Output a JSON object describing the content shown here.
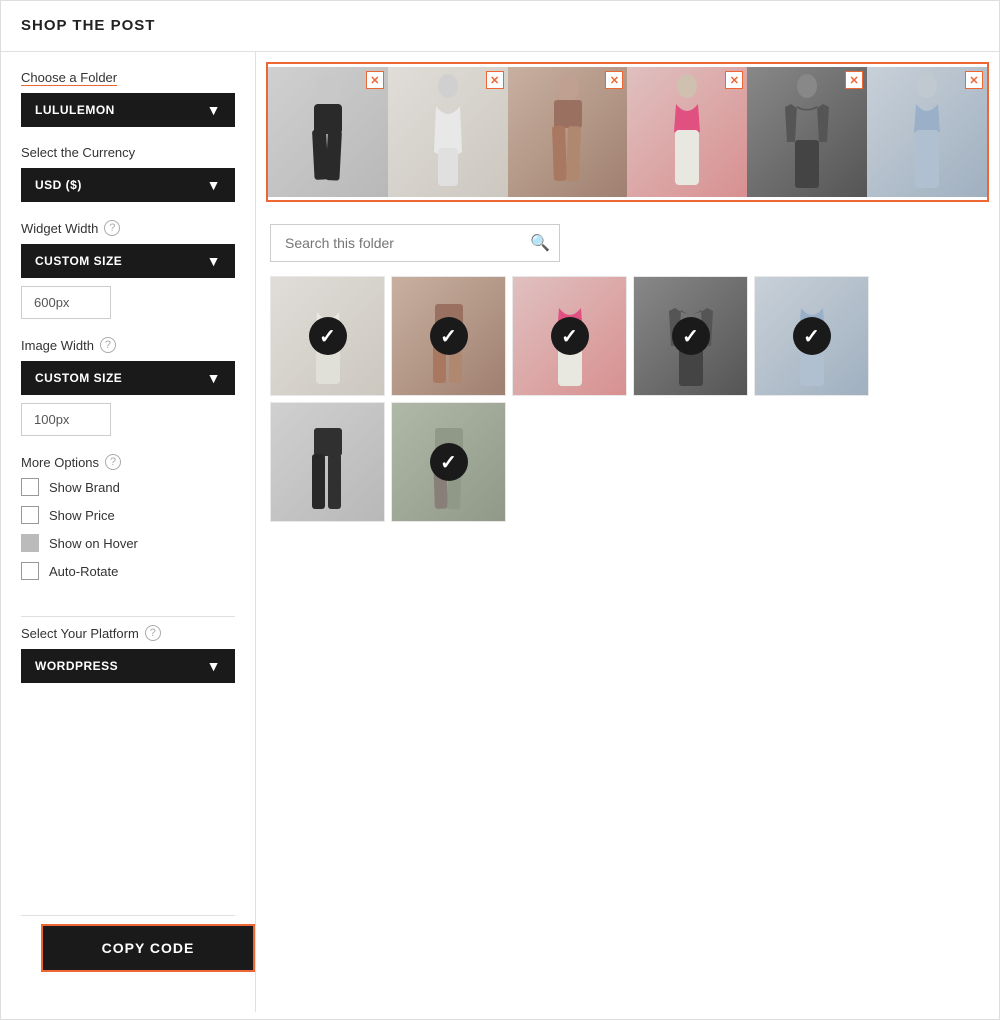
{
  "header": {
    "title": "SHOP THE POST"
  },
  "sidebar": {
    "choose_folder_label": "Choose a Folder",
    "folder_value": "LULULEMON",
    "currency_label": "Select the Currency",
    "currency_value": "USD ($)",
    "widget_width_label": "Widget Width",
    "widget_width_value": "CUSTOM SIZE",
    "widget_width_input": "600px",
    "image_width_label": "Image Width",
    "image_width_value": "CUSTOM SIZE",
    "image_width_input": "100px",
    "more_options_label": "More Options",
    "options": [
      {
        "id": "show-brand",
        "label": "Show Brand",
        "checked": false,
        "gray": false
      },
      {
        "id": "show-price",
        "label": "Show Price",
        "checked": false,
        "gray": false
      },
      {
        "id": "show-hover",
        "label": "Show on Hover",
        "checked": false,
        "gray": true
      },
      {
        "id": "auto-rotate",
        "label": "Auto-Rotate",
        "checked": false,
        "gray": false
      }
    ],
    "platform_label": "Select Your Platform",
    "platform_value": "WORDPRESS",
    "copy_code_label": "COPY CODE"
  },
  "preview": {
    "items": [
      {
        "id": 1,
        "color": "prod-1"
      },
      {
        "id": 2,
        "color": "prod-2"
      },
      {
        "id": 3,
        "color": "prod-3"
      },
      {
        "id": 4,
        "color": "prod-4"
      },
      {
        "id": 5,
        "color": "prod-5"
      },
      {
        "id": 6,
        "color": "prod-6"
      }
    ]
  },
  "folder": {
    "search_placeholder": "Search this folder",
    "search_icon": "🔍",
    "grid_items": [
      {
        "id": 1,
        "selected": true,
        "color": "prod-2"
      },
      {
        "id": 2,
        "selected": true,
        "color": "prod-3"
      },
      {
        "id": 3,
        "selected": true,
        "color": "prod-4"
      },
      {
        "id": 4,
        "selected": true,
        "color": "prod-5"
      },
      {
        "id": 5,
        "selected": true,
        "color": "prod-6"
      },
      {
        "id": 6,
        "selected": false,
        "color": "prod-1"
      },
      {
        "id": 7,
        "selected": true,
        "color": "prod-7"
      }
    ]
  },
  "icons": {
    "chevron": "▼",
    "close": "✕",
    "check": "✓",
    "info": "?"
  }
}
